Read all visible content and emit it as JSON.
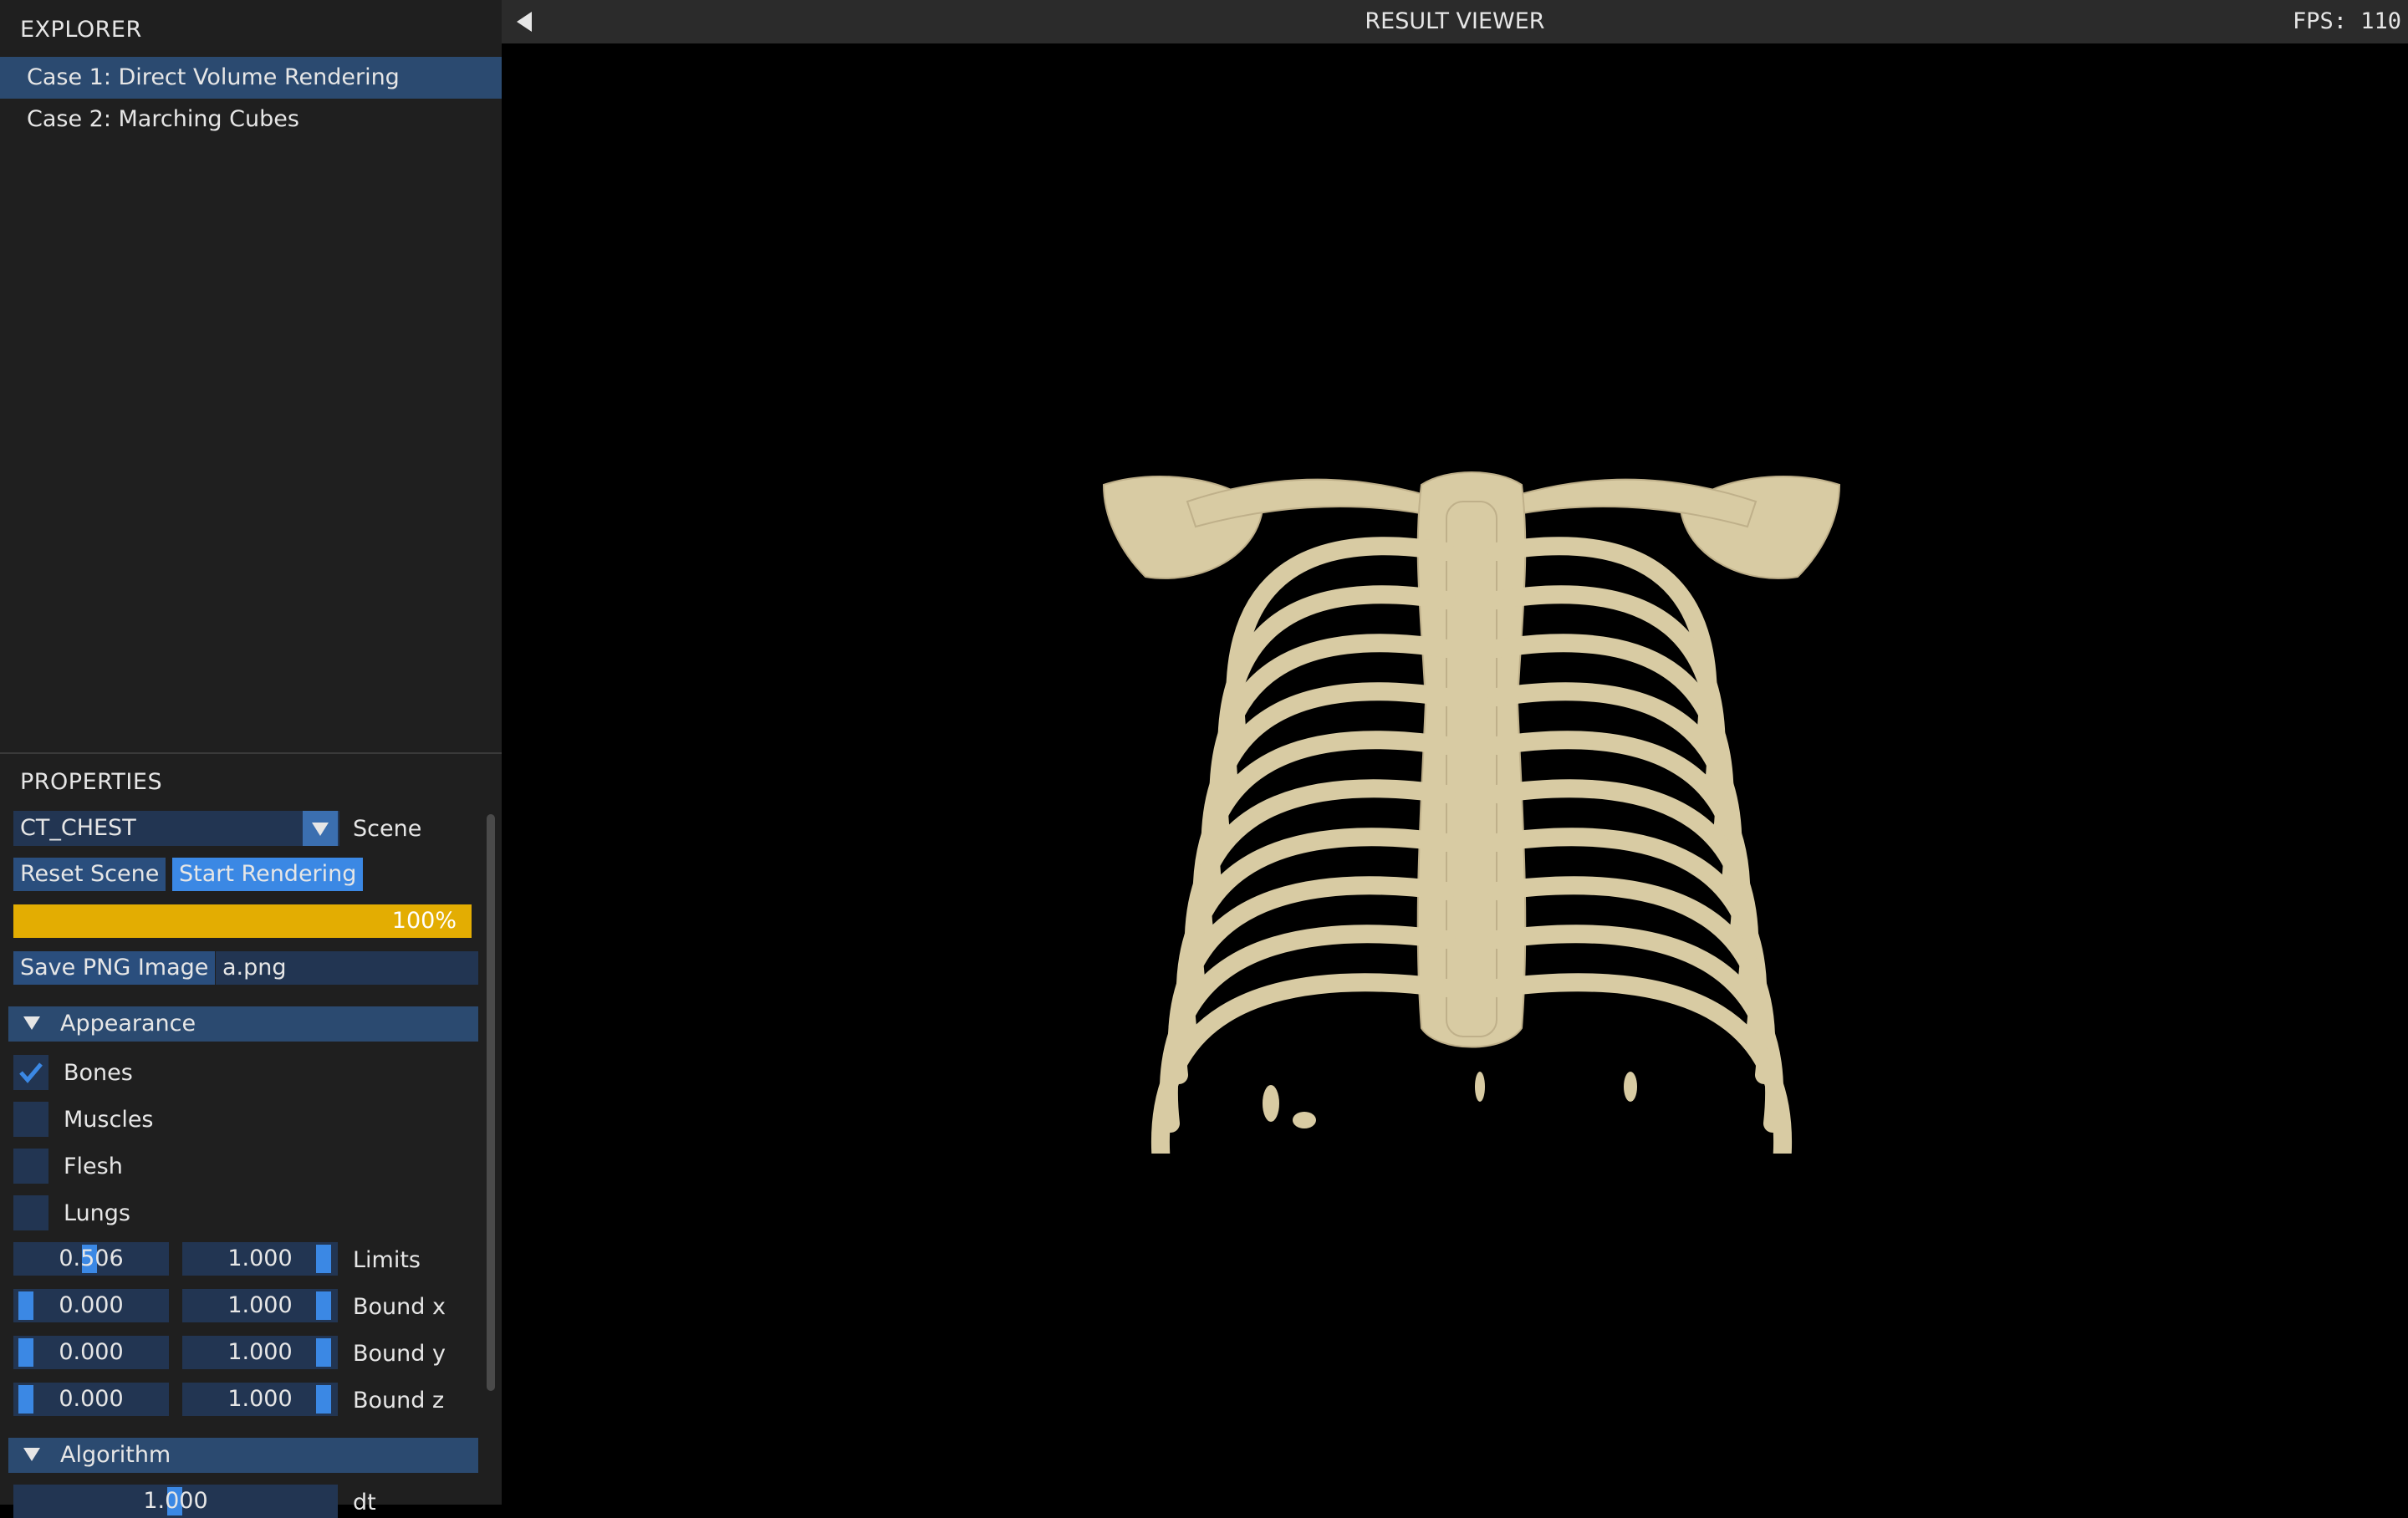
{
  "explorer": {
    "title": "EXPLORER",
    "items": [
      {
        "label": "Case 1: Direct Volume Rendering",
        "selected": true
      },
      {
        "label": "Case 2: Marching Cubes",
        "selected": false
      }
    ]
  },
  "properties": {
    "title": "PROPERTIES",
    "scene_select": {
      "value": "CT_CHEST",
      "label": "Scene"
    },
    "reset_button": "Reset Scene",
    "start_button": "Start Rendering",
    "progress": {
      "value": 1.0,
      "text": "100%"
    },
    "save_button": "Save PNG Image",
    "filename": "a.png",
    "appearance": {
      "title": "Appearance",
      "checkboxes": [
        {
          "label": "Bones",
          "checked": true
        },
        {
          "label": "Muscles",
          "checked": false
        },
        {
          "label": "Flesh",
          "checked": false
        },
        {
          "label": "Lungs",
          "checked": false
        }
      ],
      "limits": {
        "min": "0.506",
        "max": "1.000",
        "label": "Limits"
      },
      "bound_x": {
        "min": "0.000",
        "max": "1.000",
        "label": "Bound x"
      },
      "bound_y": {
        "min": "0.000",
        "max": "1.000",
        "label": "Bound y"
      },
      "bound_z": {
        "min": "0.000",
        "max": "1.000",
        "label": "Bound z"
      }
    },
    "algorithm": {
      "title": "Algorithm",
      "dt": {
        "value": "1.000",
        "label": "dt"
      }
    }
  },
  "viewer": {
    "title": "RESULT VIEWER",
    "fps": "FPS: 110",
    "bone_color": "#d8cba3"
  },
  "colors": {
    "accent": "#3b88e4",
    "widget_bg": "#223552",
    "header_bg": "#2b4a70",
    "progress": "#e3ad02"
  }
}
